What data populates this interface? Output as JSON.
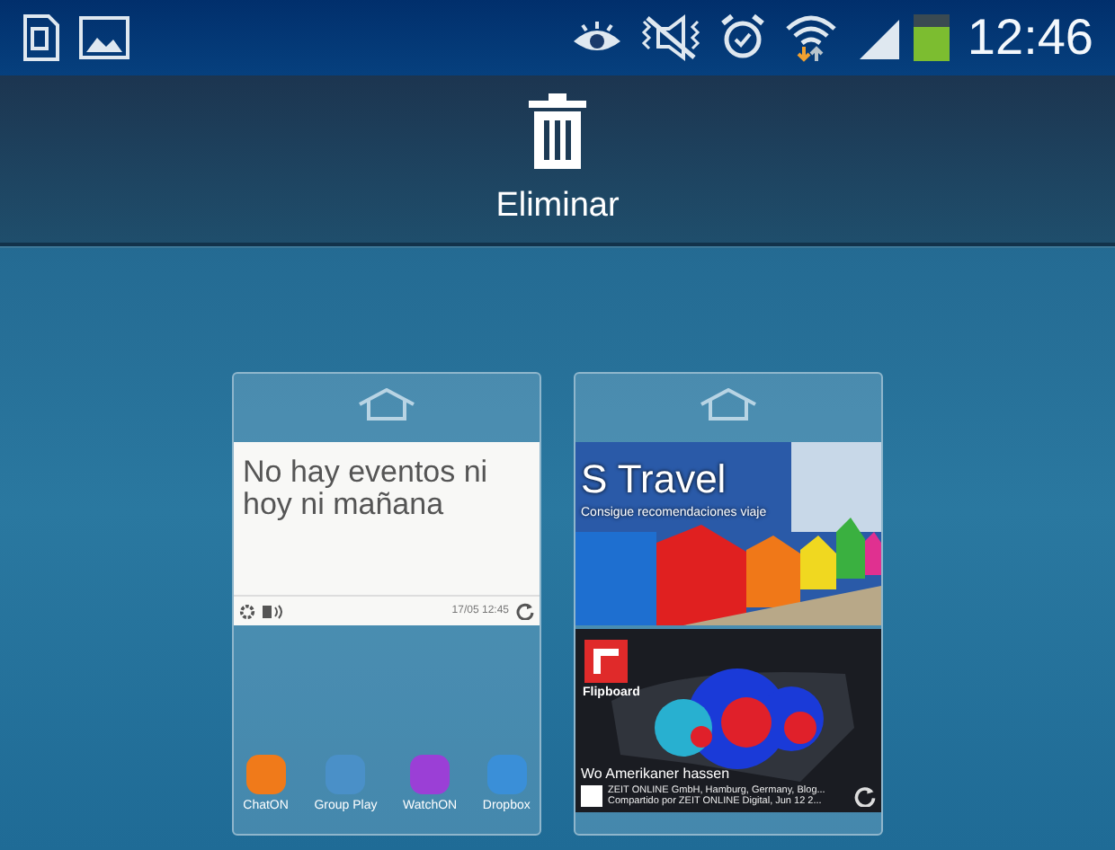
{
  "status_bar": {
    "time": "12:46"
  },
  "action_bar": {
    "delete_label": "Eliminar"
  },
  "pages": [
    {
      "kind": "home",
      "widget": {
        "kind": "calendar",
        "message": "No hay eventos ni hoy ni mañana",
        "timestamp": "17/05 12:45"
      },
      "apps": [
        {
          "label": "ChatON",
          "kind": "chat"
        },
        {
          "label": "Group Play",
          "kind": "group"
        },
        {
          "label": "WatchON",
          "kind": "watch"
        },
        {
          "label": "Dropbox",
          "kind": "box"
        }
      ]
    },
    {
      "kind": "home",
      "travel": {
        "title": "S Travel",
        "subtitle": "Consigue recomendaciones viaje"
      },
      "flipboard": {
        "brand": "Flipboard",
        "headline": "Wo Amerikaner hassen",
        "source": "ZEIT ONLINE GmbH, Hamburg, Germany, Blog...",
        "shared": "Compartido por ZEIT ONLINE Digital, Jun 12 2..."
      }
    }
  ]
}
